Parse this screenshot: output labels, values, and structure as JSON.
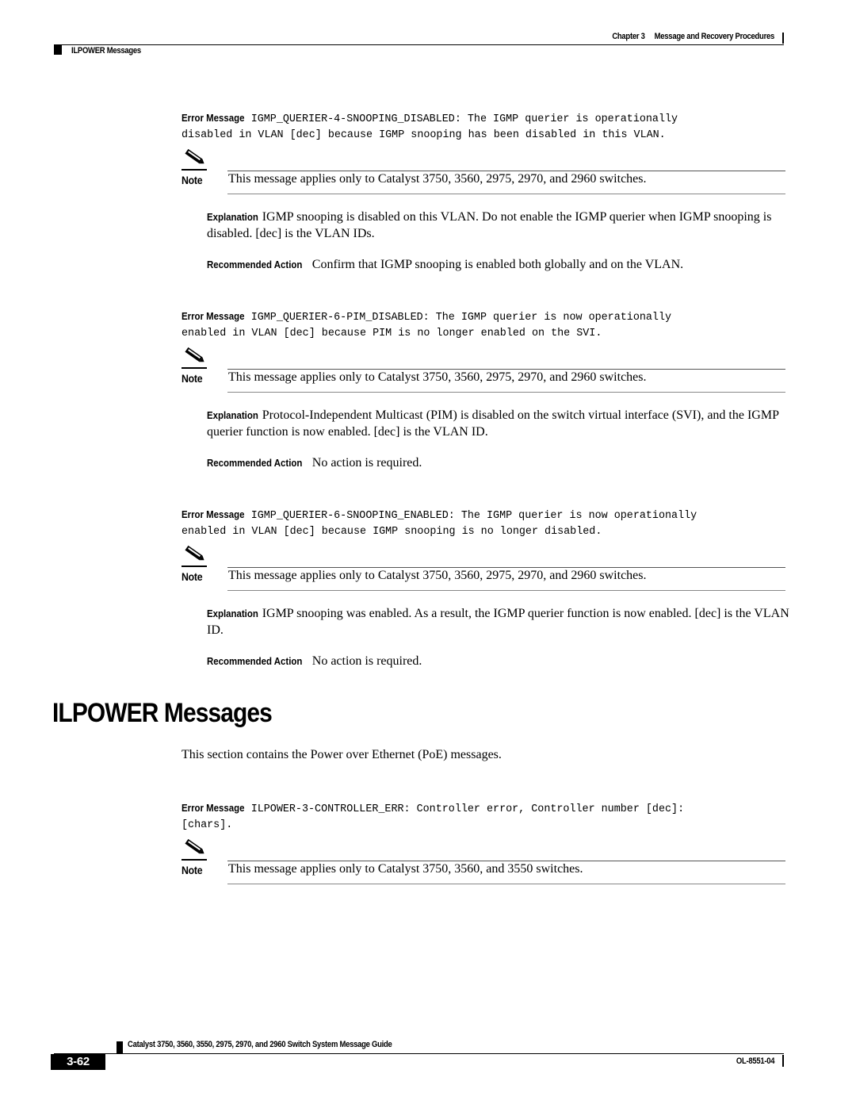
{
  "header": {
    "chapter": "Chapter 3",
    "chapter_title": "Message and Recovery Procedures",
    "section": "ILPOWER Messages"
  },
  "labels": {
    "error_message": "Error Message",
    "note": "Note",
    "explanation": "Explanation",
    "recommended_action": "Recommended Action"
  },
  "messages": [
    {
      "error_line1": "IGMP_QUERIER-4-SNOOPING_DISABLED: The IGMP querier is operationally",
      "error_line2": "disabled in VLAN [dec] because IGMP snooping has been disabled in this VLAN.",
      "note": "This message applies only to Catalyst 3750, 3560, 2975, 2970, and 2960 switches.",
      "explanation": "IGMP snooping is disabled on this VLAN. Do not enable the IGMP querier when IGMP snooping is disabled. [dec] is the VLAN IDs.",
      "action": "Confirm that IGMP snooping is enabled both globally and on the VLAN."
    },
    {
      "error_line1": "IGMP_QUERIER-6-PIM_DISABLED: The IGMP querier is now operationally",
      "error_line2": "enabled in VLAN [dec] because PIM is no longer enabled on the SVI.",
      "note": "This message applies only to Catalyst 3750, 3560, 2975, 2970, and 2960 switches.",
      "explanation": "Protocol-Independent Multicast (PIM) is disabled on the switch virtual interface (SVI), and the IGMP querier function is now enabled. [dec] is the VLAN ID.",
      "action": "No action is required."
    },
    {
      "error_line1": "IGMP_QUERIER-6-SNOOPING_ENABLED: The IGMP querier is now operationally",
      "error_line2": "enabled in VLAN [dec] because IGMP snooping is no longer disabled.",
      "note": "This message applies only to Catalyst 3750, 3560, 2975, 2970, and 2960 switches.",
      "explanation": "IGMP snooping was enabled. As a result, the IGMP querier function is now enabled. [dec] is the VLAN ID.",
      "action": "No action is required."
    }
  ],
  "section": {
    "title": "ILPOWER Messages",
    "intro": "This section contains the Power over Ethernet (PoE) messages.",
    "messages": [
      {
        "error_line1": "ILPOWER-3-CONTROLLER_ERR: Controller error, Controller number [dec]:",
        "error_line2": "[chars].",
        "note": "This message applies only to Catalyst 3750, 3560, and 3550 switches."
      }
    ]
  },
  "footer": {
    "guide_title": "Catalyst 3750, 3560, 3550, 2975, 2970, and 2960 Switch System Message Guide",
    "page_number": "3-62",
    "doc_id": "OL-8551-04"
  }
}
